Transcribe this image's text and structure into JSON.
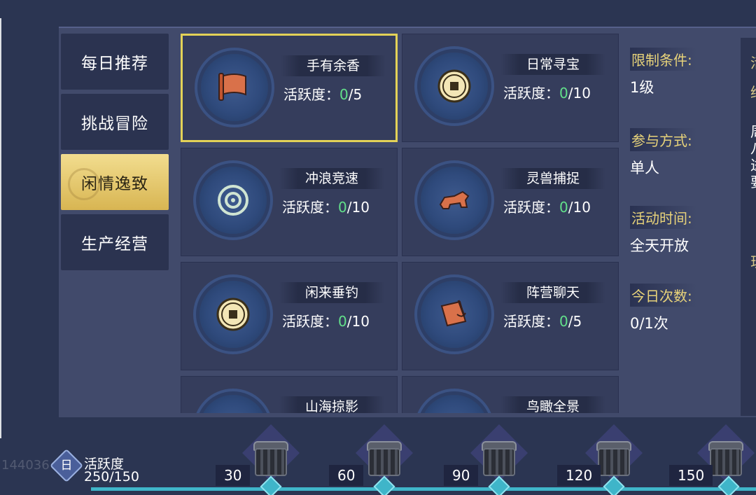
{
  "sidebar": {
    "items": [
      {
        "label": "每日推荐",
        "active": false
      },
      {
        "label": "挑战冒险",
        "active": false
      },
      {
        "label": "闲情逸致",
        "active": true
      },
      {
        "label": "生产经营",
        "active": false
      }
    ]
  },
  "activities": [
    {
      "title": "手有余香",
      "progress_label": "活跃度：",
      "current": "0",
      "total": "/5",
      "icon": "scroll-flag-icon",
      "selected": true
    },
    {
      "title": "日常寻宝",
      "progress_label": "活跃度：",
      "current": "0",
      "total": "/10",
      "icon": "coin-icon"
    },
    {
      "title": "冲浪竞速",
      "progress_label": "活跃度：",
      "current": "0",
      "total": "/10",
      "icon": "wave-ring-icon"
    },
    {
      "title": "灵兽捕捉",
      "progress_label": "活跃度：",
      "current": "0",
      "total": "/10",
      "icon": "beast-icon"
    },
    {
      "title": "闲来垂钓",
      "progress_label": "活跃度：",
      "current": "0",
      "total": "/10",
      "icon": "coin-icon"
    },
    {
      "title": "阵营聊天",
      "progress_label": "活跃度：",
      "current": "0",
      "total": "/5",
      "icon": "scroll-brush-icon"
    },
    {
      "title": "山海掠影",
      "icon": "scroll-icon"
    },
    {
      "title": "鸟瞰全景",
      "icon": "compass-icon"
    }
  ],
  "info": {
    "limit_label": "限制条件:",
    "limit_value": "1级",
    "mode_label": "参与方式:",
    "mode_value": "单人",
    "time_label": "活动时间:",
    "time_value": "全天开放",
    "count_label": "今日次数:",
    "count_value": "0/1次"
  },
  "right_panel_chars": [
    "活",
    "给",
    "周",
    "八",
    "进",
    "要",
    "现"
  ],
  "bottom": {
    "emblem_glyph": "日",
    "watermark": "144036",
    "activity_label": "活跃度",
    "activity_value": "250/150",
    "milestones": [
      "30",
      "60",
      "90",
      "120",
      "150"
    ]
  },
  "colors": {
    "accent_gold": "#e3d257",
    "progress_green": "#62e08a",
    "track_cyan": "#3fb5c9"
  }
}
